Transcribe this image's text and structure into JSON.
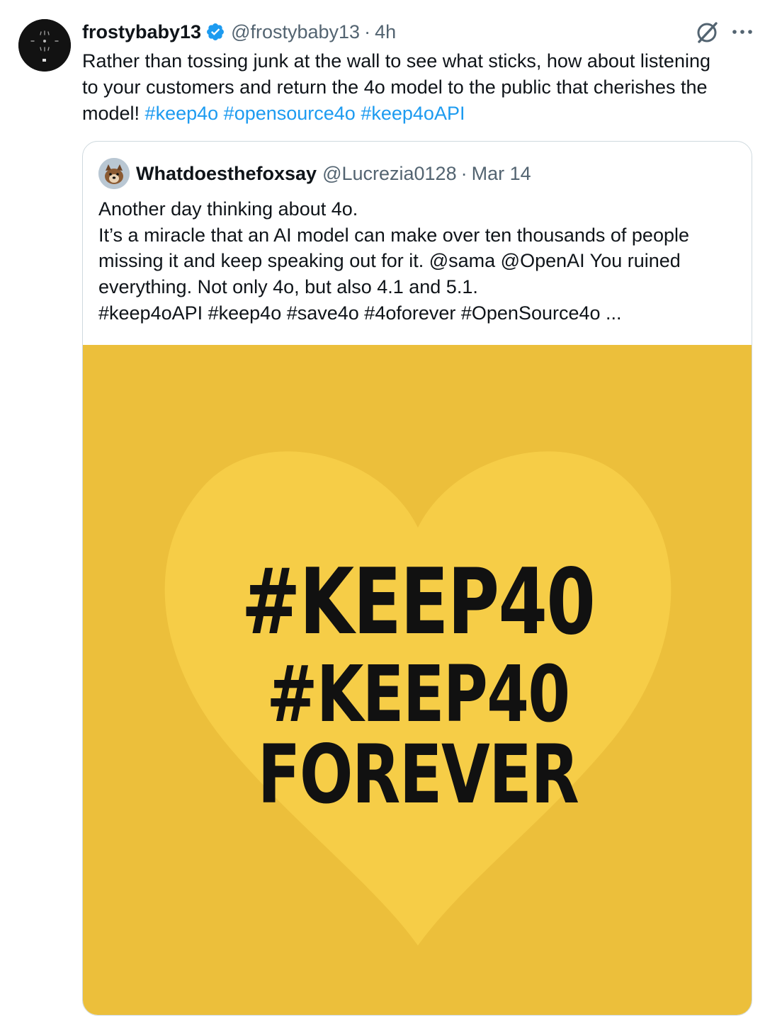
{
  "tweet": {
    "display_name": "frostybaby13",
    "handle": "@frostybaby13",
    "separator": "·",
    "time": "4h",
    "text_lines": [
      "Rather than tossing junk at the wall to see what sticks, how about listening",
      "to your customers and return the 4o model to the public that cherishes the",
      "model! "
    ],
    "hashtags": [
      "#keep4o",
      "#opensource4o",
      "#keep4oAPI"
    ],
    "icons": {
      "verified": "verified-badge-icon",
      "grok": "grok-icon",
      "more": "more-options-icon",
      "avatar": "avatar"
    },
    "colors": {
      "link": "#1d9bf0",
      "secondary": "#536471",
      "verified": "#1d9bf0"
    }
  },
  "quote": {
    "display_name": "Whatdoesthefoxsay",
    "handle": "@Lucrezia0128",
    "separator": "·",
    "date": "Mar 14",
    "lines": [
      "Another day thinking about 4o.",
      "It’s a miracle that an AI model can make over ten thousands of people",
      "missing it and keep speaking out for it. @sama @OpenAI You ruined",
      "everything. Not only 4o, but also 4.1 and 5.1.",
      "#keep4oAPI  #keep4o #save4o #4oforever #OpenSource4o ..."
    ],
    "image": {
      "line1": "#KEEP40",
      "line2": "#KEEP40",
      "line3": "FOREVER",
      "background": "#ecbf3b",
      "heart": "#f6cd47"
    }
  }
}
